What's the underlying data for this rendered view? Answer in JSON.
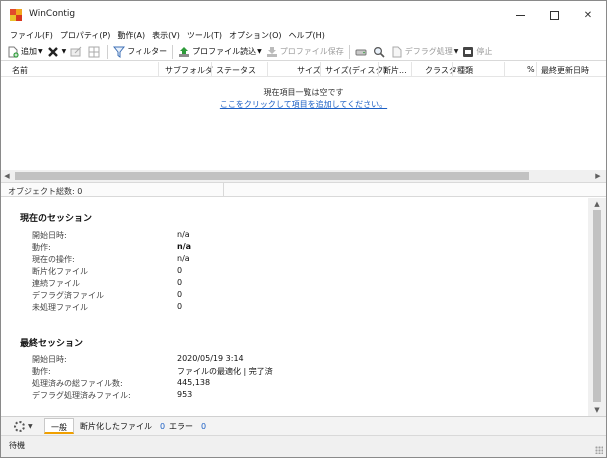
{
  "window": {
    "title": "WinContig"
  },
  "menu": [
    "ファイル(F)",
    "プロパティ(P)",
    "動作(A)",
    "表示(V)",
    "ツール(T)",
    "オプション(O)",
    "ヘルプ(H)"
  ],
  "toolbar": {
    "add": "追加",
    "filter": "フィルター",
    "profile_load": "プロファイル読込",
    "profile_save": "プロファイル保存",
    "defrag": "デフラグ処理",
    "stop": "停止"
  },
  "columns": [
    "名前",
    "サブフォルダ",
    "ステータス",
    "サイズ",
    "サイズ(ディスク)",
    "断片...",
    "クラスタ",
    "種類",
    "%",
    "最終更新日時"
  ],
  "list": {
    "empty_message": "現在項目一覧は空です",
    "add_link": "ここをクリックして項目を追加してください。"
  },
  "object_total": "オブジェクト総数: 0",
  "current_session": {
    "title": "現在のセッション",
    "rows": [
      {
        "label": "開始日時:",
        "value": "n/a"
      },
      {
        "label": "動作:",
        "value": "n/a"
      },
      {
        "label": "現在の操作:",
        "value": "n/a"
      },
      {
        "label": "断片化ファイル",
        "value": "0"
      },
      {
        "label": "連続ファイル",
        "value": "0"
      },
      {
        "label": "デフラグ済ファイル",
        "value": "0"
      },
      {
        "label": "未処理ファイル",
        "value": "0"
      }
    ]
  },
  "last_session": {
    "title": "最終セッション",
    "rows": [
      {
        "label": "開始日時:",
        "value": "2020/05/19 3:14"
      },
      {
        "label": "動作:",
        "value": "ファイルの最適化 | 完了済"
      },
      {
        "label": "処理済みの総ファイル数:",
        "value": "445,138"
      },
      {
        "label": "デフラグ処理済みファイル:",
        "value": "953"
      }
    ]
  },
  "tabs": {
    "general": "一般",
    "fragmented": "断片化したファイル",
    "fragmented_count": "0",
    "errors": "エラー",
    "errors_count": "0"
  },
  "status": "待機",
  "colors": {
    "link": "#1b5fc4",
    "active_tab_accent": "#f0a000"
  }
}
